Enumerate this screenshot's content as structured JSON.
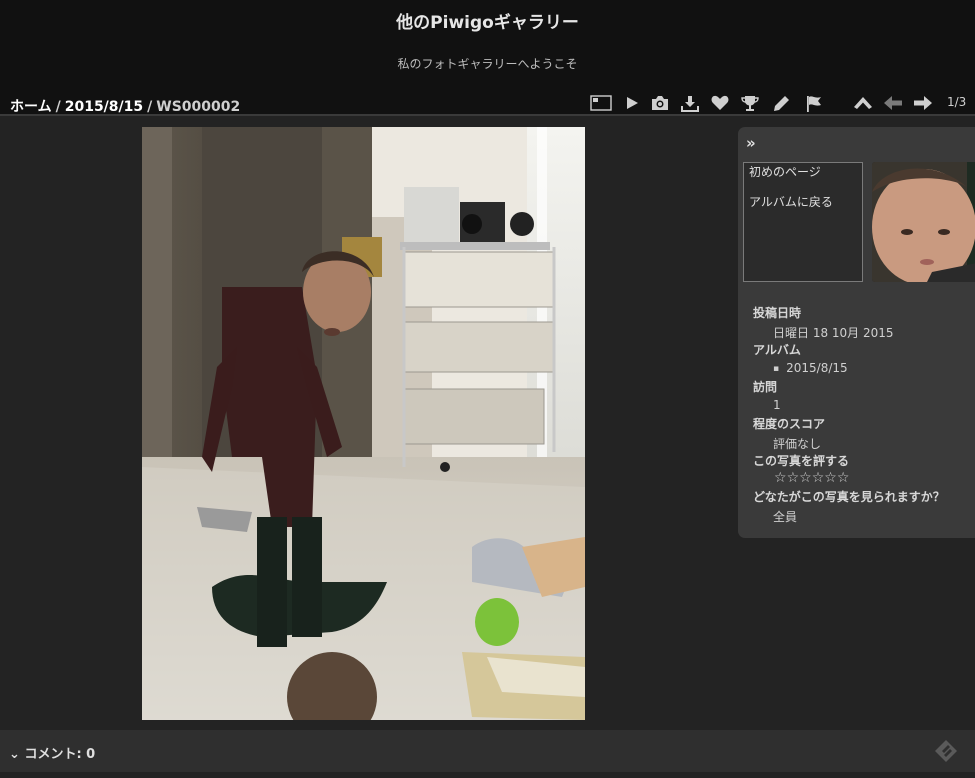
{
  "header": {
    "title": "他のPiwigoギャラリー",
    "subtitle": "私のフォトギャラリーへようこそ"
  },
  "breadcrumb": {
    "home": "ホーム",
    "separator": "/",
    "album": "2015/8/15",
    "current": "WS000002"
  },
  "toolbar": {
    "icons": [
      "picture-size-icon",
      "slideshow-play-icon",
      "camera-icon",
      "download-icon",
      "heart-favorite-icon",
      "trophy-icon",
      "pencil-edit-icon",
      "flag-icon",
      "up-arrow-icon",
      "left-arrow-icon",
      "right-arrow-icon"
    ],
    "counter": "1/3"
  },
  "panel": {
    "collapse": "»",
    "first_page": "初めのページ",
    "back_to_album": "アルバムに戻る",
    "posted_label": "投稿日時",
    "posted_value": "日曜日 18 10月 2015",
    "album_label": "アルバム",
    "album_value": "2015/8/15",
    "visits_label": "訪問",
    "visits_value": "1",
    "score_label": "程度のスコア",
    "score_value": "評価なし",
    "rate_label": "この写真を評する",
    "rate_stars": [
      "☆",
      "☆",
      "☆",
      "☆",
      "☆",
      "☆"
    ],
    "who_label": "どなたがこの写真を見られますか？",
    "who_value": "全員"
  },
  "comments": {
    "toggle": "コメント: 0"
  },
  "colors": {
    "background": "#232323",
    "header": "#111111",
    "panel": "#3a3a3a",
    "text": "#d8d8d8"
  }
}
